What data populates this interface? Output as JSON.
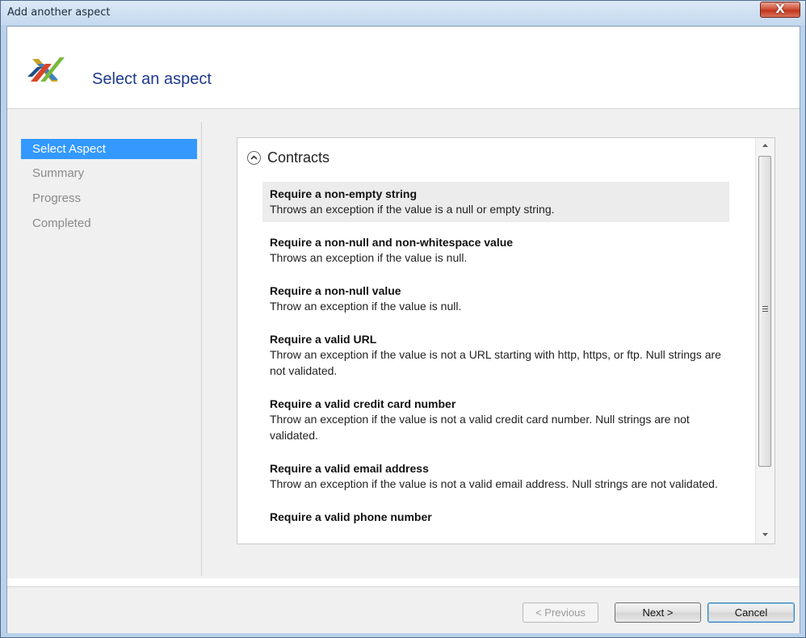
{
  "window": {
    "title": "Add another aspect",
    "close_label": "X"
  },
  "header": {
    "title": "Select an aspect"
  },
  "nav": {
    "items": [
      "Select Aspect",
      "Summary",
      "Progress",
      "Completed"
    ],
    "active_index": 0
  },
  "group": {
    "title": "Contracts"
  },
  "aspects": [
    {
      "title": "Require a non-empty string",
      "desc": "Throws an exception if the value is a null or empty string."
    },
    {
      "title": "Require a non-null and non-whitespace value",
      "desc": "Throws an exception if the value is null."
    },
    {
      "title": "Require a non-null value",
      "desc": "Throw an exception if the value is null."
    },
    {
      "title": "Require a valid URL",
      "desc": "Throw an exception if the value is not a URL starting with http, https, or ftp. Null strings are not validated."
    },
    {
      "title": "Require a valid credit card number",
      "desc": "Throw an exception if the value is not a valid credit card number. Null strings are not validated."
    },
    {
      "title": "Require a valid email address",
      "desc": "Throw an exception if the value is not a valid email address. Null strings are not validated."
    },
    {
      "title": "Require a valid phone number",
      "desc": ""
    }
  ],
  "buttons": {
    "previous": "< Previous",
    "next": "Next >",
    "cancel": "Cancel"
  },
  "colors": {
    "accent": "#3399ff",
    "title_blue": "#1f3a8c"
  }
}
